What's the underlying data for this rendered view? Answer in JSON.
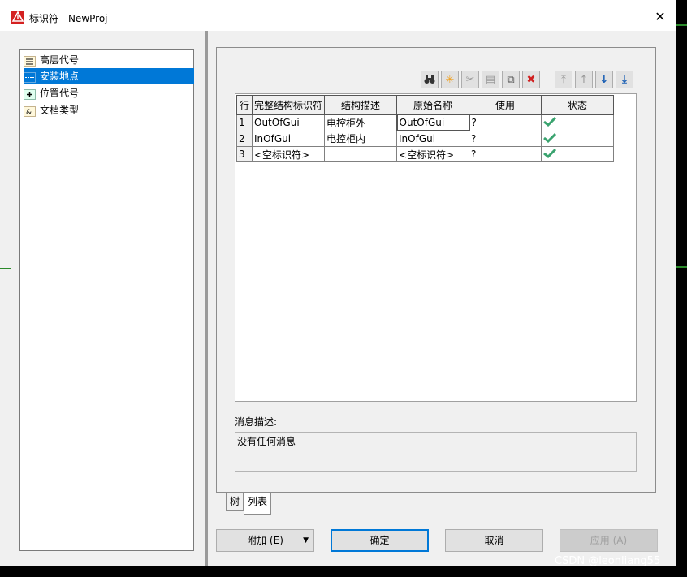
{
  "window": {
    "title": "标识符 - NewProj",
    "close_symbol": "✕"
  },
  "sidebar": {
    "items": [
      {
        "label": "高层代号",
        "icon": "higher-level-icon",
        "selected": false
      },
      {
        "label": "安装地点",
        "icon": "location-icon",
        "selected": true
      },
      {
        "label": "位置代号",
        "icon": "position-icon",
        "selected": false
      },
      {
        "label": "文档类型",
        "icon": "document-type-icon",
        "selected": false
      }
    ]
  },
  "toolbar": {
    "buttons": [
      "binoculars-icon",
      "new-icon",
      "cut-icon",
      "paste-icon",
      "copy-icon",
      "delete-icon",
      "move-top-icon",
      "move-up-icon",
      "move-down-icon",
      "move-bottom-icon"
    ]
  },
  "grid": {
    "headers": [
      "行",
      "完整结构标识符",
      "结构描述",
      "原始名称",
      "使用",
      "状态"
    ],
    "rows": [
      {
        "num": "1",
        "full_id": "OutOfGui",
        "desc": "电控柜外",
        "orig": "OutOfGui",
        "use": "?",
        "status": "check"
      },
      {
        "num": "2",
        "full_id": "InOfGui",
        "desc": "电控柜内",
        "orig": "InOfGui",
        "use": "?",
        "status": "check"
      },
      {
        "num": "3",
        "full_id": "<空标识符>",
        "desc": "",
        "orig": "<空标识符>",
        "use": "?",
        "status": "check"
      }
    ]
  },
  "message": {
    "label": "消息描述:",
    "text": "没有任何消息"
  },
  "tabs": [
    {
      "label": "树"
    },
    {
      "label": "列表"
    }
  ],
  "buttons": {
    "attach": "附加 (E)",
    "ok": "确定",
    "cancel": "取消",
    "apply": "应用 (A)"
  },
  "watermark": "CSDN @leonliang55",
  "colors": {
    "selection": "#0078d7",
    "check": "#3aa36f",
    "delete": "#d02020"
  }
}
